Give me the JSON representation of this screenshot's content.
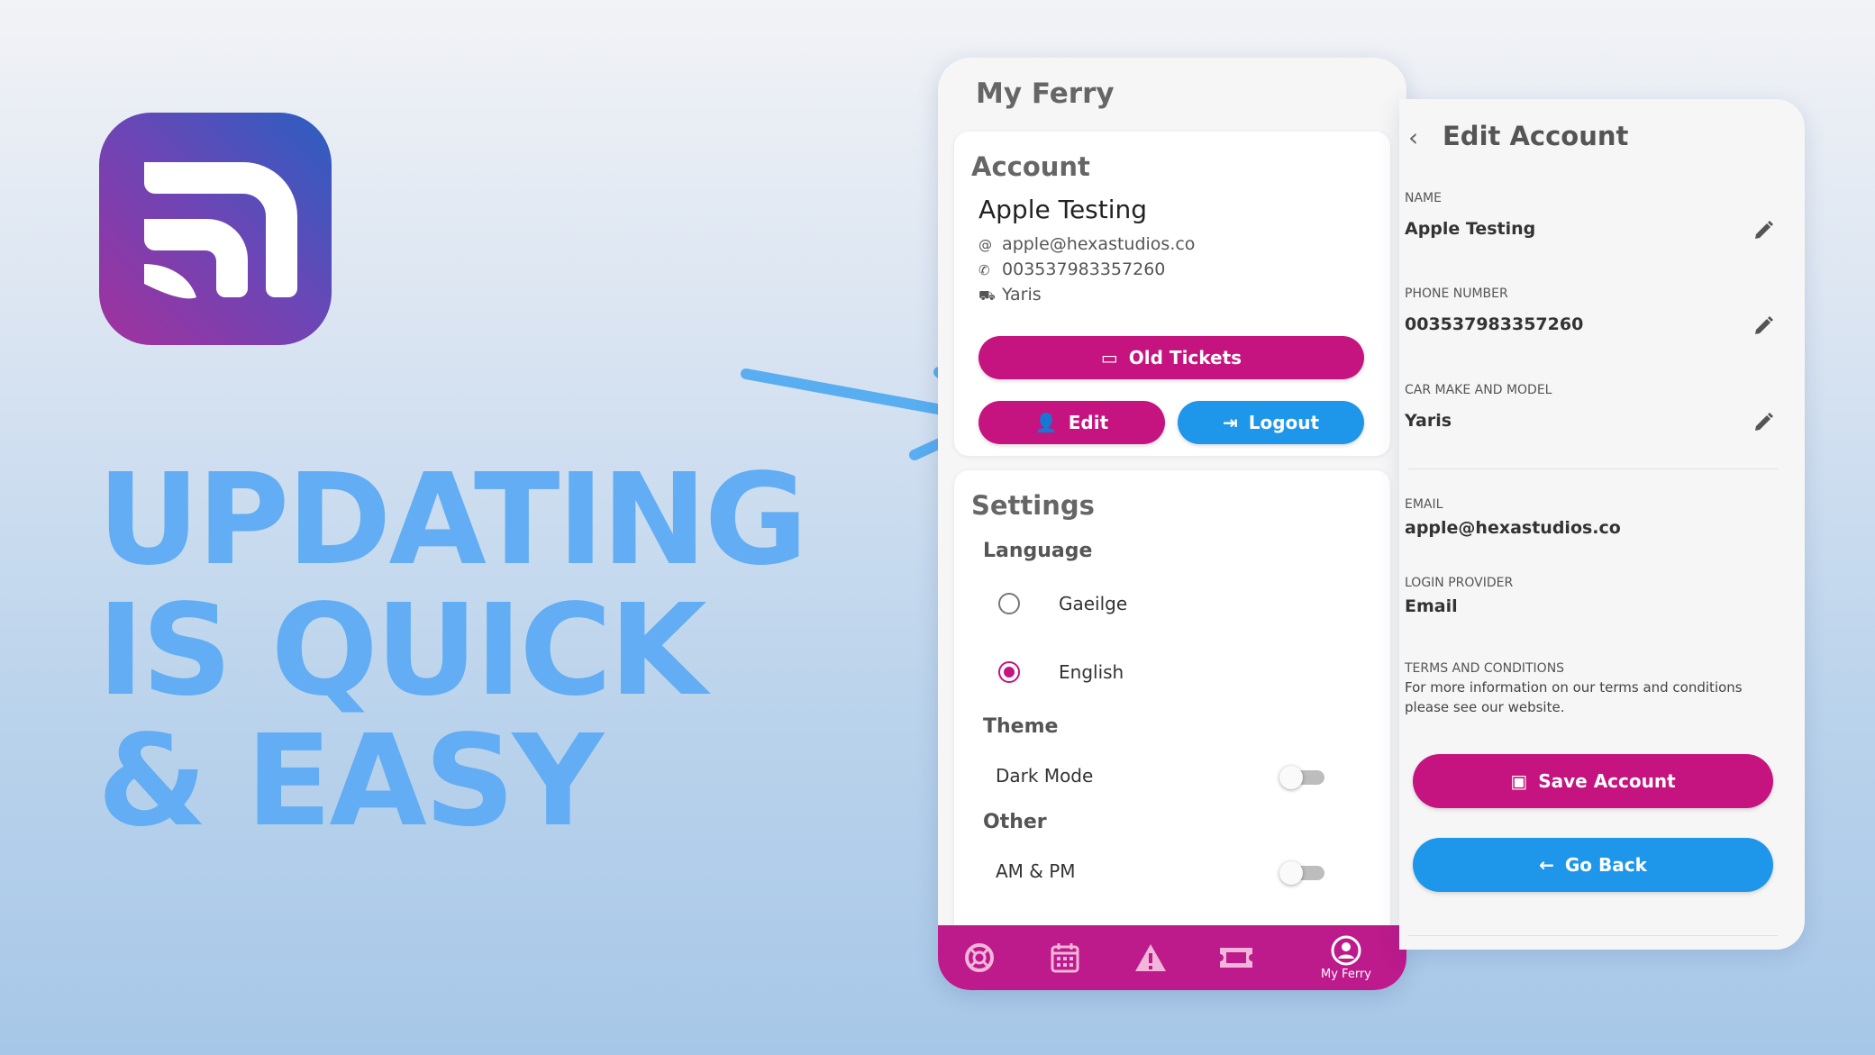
{
  "colors": {
    "magenta": "#c5137f",
    "blue": "#1e96ea",
    "headline": "#62adf3",
    "nav": "#bd1a8c"
  },
  "headline": {
    "lines": [
      "UPDATING",
      "IS QUICK",
      "& EASY"
    ]
  },
  "app": {
    "title": "My Ferry",
    "account": {
      "heading": "Account",
      "name": "Apple Testing",
      "email": "apple@hexastudios.co",
      "phone": "003537983357260",
      "car": "Yaris",
      "email_icon": "at-icon",
      "phone_icon": "phone-icon",
      "car_icon": "car-icon",
      "old_tickets_label": "Old Tickets",
      "edit_label": "Edit",
      "logout_label": "Logout"
    },
    "settings": {
      "heading": "Settings",
      "language_heading": "Language",
      "languages": [
        "Gaeilge",
        "English"
      ],
      "selected_language": "English",
      "theme_heading": "Theme",
      "dark_mode_label": "Dark Mode",
      "dark_mode_on": false,
      "other_heading": "Other",
      "ampm_label": "AM & PM",
      "ampm_on": false
    },
    "nav": {
      "items": [
        "lifebuoy-icon",
        "calendar-icon",
        "warning-icon",
        "ticket-icon",
        "account-icon"
      ],
      "active_label": "My Ferry"
    }
  },
  "edit_account": {
    "title": "Edit Account",
    "name_label": "NAME",
    "name_value": "Apple Testing",
    "phone_label": "PHONE NUMBER",
    "phone_value": "003537983357260",
    "car_label": "CAR MAKE AND MODEL",
    "car_value": "Yaris",
    "email_label": "EMAIL",
    "email_value": "apple@hexastudios.co",
    "provider_label": "LOGIN PROVIDER",
    "provider_value": "Email",
    "terms_label": "TERMS AND CONDITIONS",
    "terms_line1": "For more information on our terms and conditions",
    "terms_line2": "please see our website.",
    "save_label": "Save Account",
    "back_label": "Go Back"
  }
}
